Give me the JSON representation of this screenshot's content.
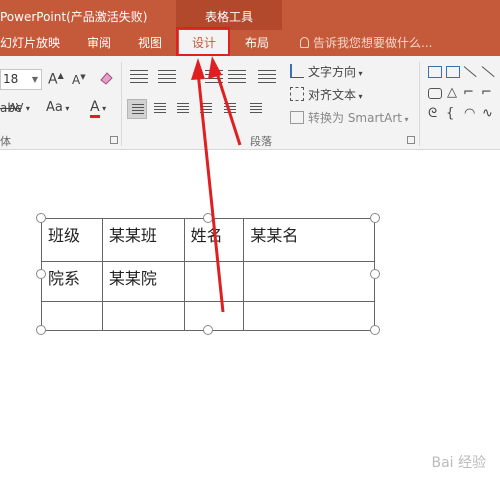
{
  "app": {
    "title": "PowerPoint(产品激活失败)"
  },
  "context_group": {
    "title": "表格工具"
  },
  "tabs": [
    {
      "label": "幻灯片放映"
    },
    {
      "label": "审阅"
    },
    {
      "label": "视图"
    },
    {
      "label": "设计",
      "active": true
    },
    {
      "label": "布局"
    }
  ],
  "tell_me": {
    "placeholder": "告诉我您想要做什么..."
  },
  "ribbon": {
    "font_size": "18",
    "grow_font": "A",
    "shrink_font": "A",
    "char_spacing": "AV",
    "change_case": "Aa",
    "font_color": "A",
    "text_direction": "文字方向",
    "align_text": "对齐文本",
    "convert_smartart": "转换为 SmartArt",
    "groups": {
      "font": "体",
      "paragraph": "段落"
    }
  },
  "table": {
    "rows": [
      [
        "班级",
        "某某班",
        "姓名",
        "某某名"
      ],
      [
        "院系",
        "某某院",
        "",
        ""
      ],
      [
        "",
        "",
        "",
        ""
      ]
    ]
  },
  "watermark": "Bai 经验",
  "colors": {
    "accent": "#c55a3b",
    "contextual": "#b2492d",
    "annotation": "#e02020"
  }
}
